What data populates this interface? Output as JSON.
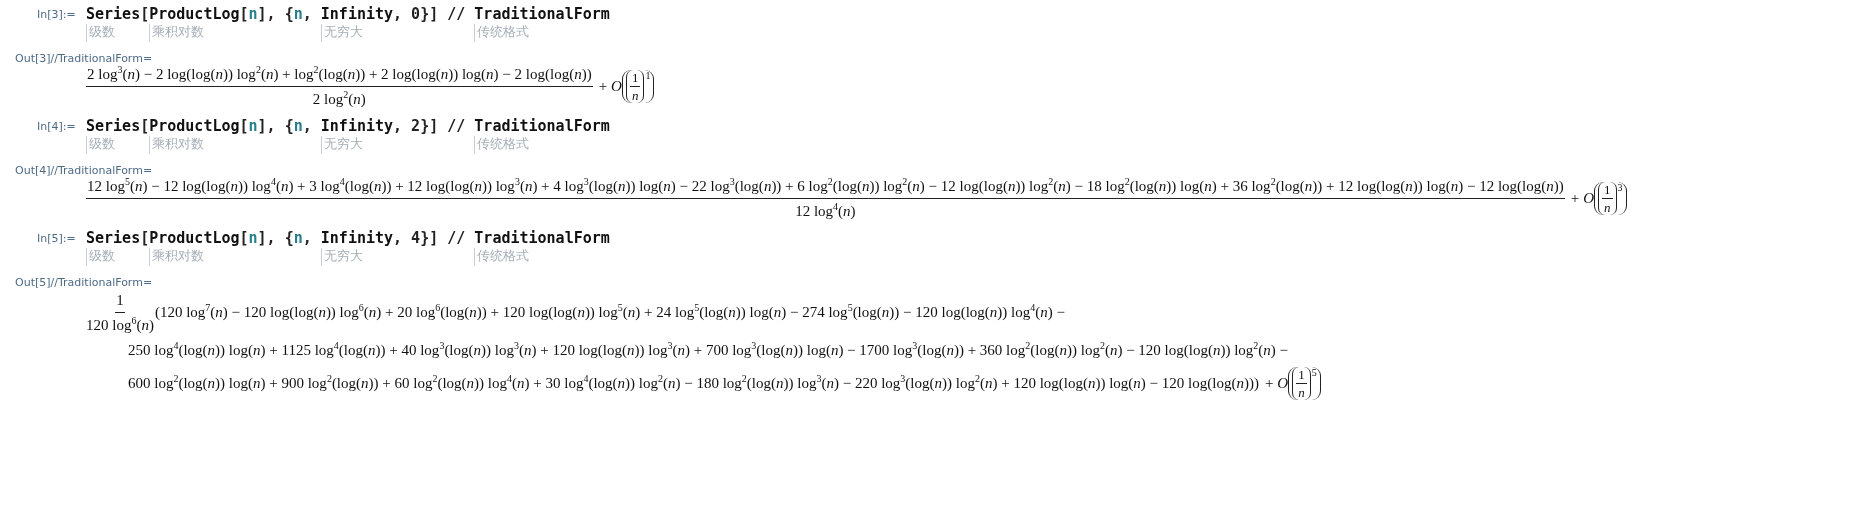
{
  "cells": [
    {
      "input": {
        "label": "In[3]:=",
        "segments": [
          {
            "text": "Series",
            "kind": "symbol",
            "hint": "级数"
          },
          {
            "text": "[",
            "kind": "plain"
          },
          {
            "text": "ProductLog",
            "kind": "symbol",
            "hint": "乘积对数"
          },
          {
            "text": "[",
            "kind": "plain"
          },
          {
            "text": "n",
            "kind": "var"
          },
          {
            "text": "], {",
            "kind": "plain"
          },
          {
            "text": "n",
            "kind": "var"
          },
          {
            "text": ", ",
            "kind": "plain"
          },
          {
            "text": "Infinity",
            "kind": "symbol",
            "hint": "无穷大"
          },
          {
            "text": ", 0}] // ",
            "kind": "plain"
          },
          {
            "text": "TraditionalForm",
            "kind": "symbol",
            "hint": "传统格式"
          }
        ]
      },
      "output": {
        "label": "Out[3]//TraditionalForm=",
        "kind": "fraction",
        "numerator": "2 log$^{3}$(*n*) − 2 log(log(*n*)) log$^{2}$(*n*) + log$^{2}$(log(*n*)) + 2 log(log(*n*)) log(*n*) − 2 log(log(*n*))",
        "denominator": "2 log$^{2}$(*n*)",
        "order": {
          "sign": "+",
          "symbol": "O",
          "numerator": "1",
          "denominator": "n",
          "power": "1"
        }
      }
    },
    {
      "input": {
        "label": "In[4]:=",
        "segments": [
          {
            "text": "Series",
            "kind": "symbol",
            "hint": "级数"
          },
          {
            "text": "[",
            "kind": "plain"
          },
          {
            "text": "ProductLog",
            "kind": "symbol",
            "hint": "乘积对数"
          },
          {
            "text": "[",
            "kind": "plain"
          },
          {
            "text": "n",
            "kind": "var"
          },
          {
            "text": "], {",
            "kind": "plain"
          },
          {
            "text": "n",
            "kind": "var"
          },
          {
            "text": ", ",
            "kind": "plain"
          },
          {
            "text": "Infinity",
            "kind": "symbol",
            "hint": "无穷大"
          },
          {
            "text": ", 2}] // ",
            "kind": "plain"
          },
          {
            "text": "TraditionalForm",
            "kind": "symbol",
            "hint": "传统格式"
          }
        ]
      },
      "output": {
        "label": "Out[4]//TraditionalForm=",
        "kind": "fraction",
        "numerator": "12 log$^{5}$(*n*) − 12 log(log(*n*)) log$^{4}$(*n*) + 3 log$^{4}$(log(*n*)) + 12 log(log(*n*)) log$^{3}$(*n*) + 4 log$^{3}$(log(*n*)) log(*n*) − 22 log$^{3}$(log(*n*)) + 6 log$^{2}$(log(*n*)) log$^{2}$(*n*) − 12 log(log(*n*)) log$^{2}$(*n*) − 18 log$^{2}$(log(*n*)) log(*n*) + 36 log$^{2}$(log(*n*)) + 12 log(log(*n*)) log(*n*) − 12 log(log(*n*))",
        "denominator": "12 log$^{4}$(*n*)",
        "order": {
          "sign": "+",
          "symbol": "O",
          "numerator": "1",
          "denominator": "n",
          "power": "3"
        }
      }
    },
    {
      "input": {
        "label": "In[5]:=",
        "segments": [
          {
            "text": "Series",
            "kind": "symbol",
            "hint": "级数"
          },
          {
            "text": "[",
            "kind": "plain"
          },
          {
            "text": "ProductLog",
            "kind": "symbol",
            "hint": "乘积对数"
          },
          {
            "text": "[",
            "kind": "plain"
          },
          {
            "text": "n",
            "kind": "var"
          },
          {
            "text": "], {",
            "kind": "plain"
          },
          {
            "text": "n",
            "kind": "var"
          },
          {
            "text": ", ",
            "kind": "plain"
          },
          {
            "text": "Infinity",
            "kind": "symbol",
            "hint": "无穷大"
          },
          {
            "text": ", 4}] // ",
            "kind": "plain"
          },
          {
            "text": "TraditionalForm",
            "kind": "symbol",
            "hint": "传统格式"
          }
        ]
      },
      "output": {
        "label": "Out[5]//TraditionalForm=",
        "kind": "scaled",
        "factor": {
          "numerator": "1",
          "denominator": "120 log$^{6}$(*n*)"
        },
        "lines": [
          "(120 log$^{7}$(*n*) − 120 log(log(*n*)) log$^{6}$(*n*) + 20 log$^{6}$(log(*n*)) + 120 log(log(*n*)) log$^{5}$(*n*) + 24 log$^{5}$(log(*n*)) log(*n*) − 274 log$^{5}$(log(*n*)) − 120 log(log(*n*)) log$^{4}$(*n*) −",
          "250 log$^{4}$(log(*n*)) log(*n*) + 1125 log$^{4}$(log(*n*)) + 40 log$^{3}$(log(*n*)) log$^{3}$(*n*) + 120 log(log(*n*)) log$^{3}$(*n*) + 700 log$^{3}$(log(*n*)) log(*n*) − 1700 log$^{3}$(log(*n*)) + 360 log$^{2}$(log(*n*)) log$^{2}$(*n*) − 120 log(log(*n*)) log$^{2}$(*n*) −",
          "600 log$^{2}$(log(*n*)) log(*n*) + 900 log$^{2}$(log(*n*)) + 60 log$^{2}$(log(*n*)) log$^{4}$(*n*) + 30 log$^{4}$(log(*n*)) log$^{2}$(*n*) − 180 log$^{2}$(log(*n*)) log$^{3}$(*n*) − 220 log$^{3}$(log(*n*)) log$^{2}$(*n*) + 120 log(log(*n*)) log(*n*) − 120 log(log(*n*)))"
        ],
        "order": {
          "sign": "+",
          "symbol": "O",
          "numerator": "1",
          "denominator": "n",
          "power": "5"
        }
      }
    }
  ]
}
